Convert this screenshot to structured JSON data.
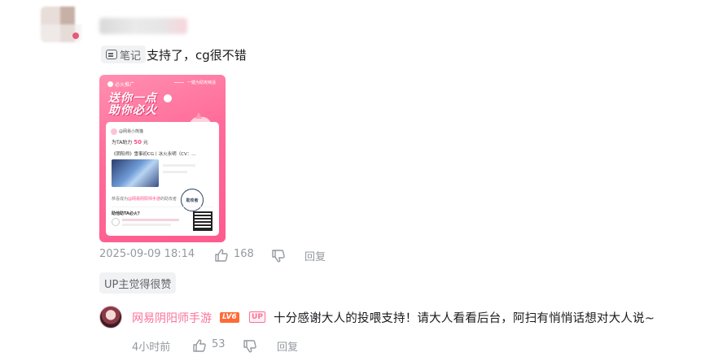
{
  "comment": {
    "note_tag": "笔记",
    "text": "支持了，cg很不错",
    "card": {
      "logo_text": "必火推广",
      "top_label": "一键为助攻喊话",
      "headline_line1": "送你一点",
      "headline_line2": "助你必火",
      "panel_user": "@网易小熊猫",
      "panel_power_prefix": "为TA助力",
      "panel_power_value": "50",
      "panel_power_suffix": "元",
      "panel_video_title": "《阴阳师》雪事初CG丨冰火永明（CV：...",
      "panel_ack_prefix": "恭喜成为",
      "panel_ack_highlight": "@网易阴阳师手游",
      "panel_ack_suffix": "的助攻者",
      "panel_question": "助他助TA必火?",
      "stamp_text": "助攻者"
    },
    "time": "2025-09-09 18:14",
    "like_count": "168",
    "reply_label": "回复",
    "up_liked_label": "UP主觉得很赞"
  },
  "reply": {
    "username": "网易阴阳师手游",
    "level_badge": "LV6",
    "up_badge": "UP",
    "text": "十分感谢大人的投喂支持！请大人看看后台，阿扫有悄悄话想对大人说~",
    "time": "4小时前",
    "like_count": "53",
    "reply_label": "回复"
  },
  "colors": {
    "accent_pink": "#fb7299",
    "meta_gray": "#9499a0",
    "level_orange": "#ff6a36",
    "card_pink": "#ff6a98"
  }
}
